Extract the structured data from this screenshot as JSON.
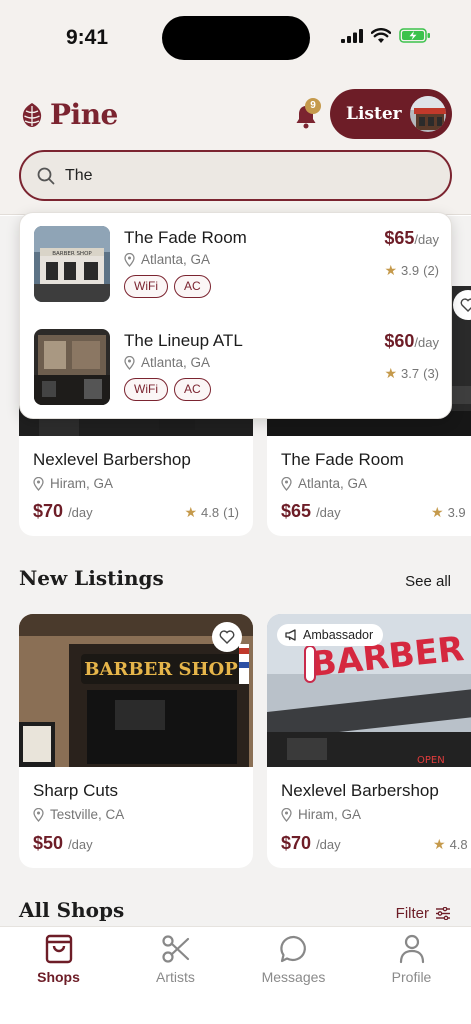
{
  "status": {
    "time": "9:41"
  },
  "header": {
    "logo_text": "Pine",
    "notification_count": "9",
    "lister_label": "Lister",
    "search_value": "The"
  },
  "search_results": [
    {
      "name": "The Fade Room",
      "location": "Atlanta, GA",
      "tags": [
        "WiFi",
        "AC"
      ],
      "price": "$65",
      "per": "/day",
      "rating": "3.9",
      "reviews": "(2)"
    },
    {
      "name": "The Lineup ATL",
      "location": "Atlanta, GA",
      "tags": [
        "WiFi",
        "AC"
      ],
      "price": "$60",
      "per": "/day",
      "rating": "3.7",
      "reviews": "(3)"
    }
  ],
  "featured": [
    {
      "name": "Nexlevel Barbershop",
      "location": "Hiram, GA",
      "price": "$70",
      "per": "/day",
      "rating": "4.8",
      "reviews": "(1)"
    },
    {
      "name": "The Fade Room",
      "location": "Atlanta, GA",
      "price": "$65",
      "per": "/day",
      "rating": "3.9",
      "reviews": ""
    }
  ],
  "new_listings": {
    "title": "New Listings",
    "see_all": "See all",
    "items": [
      {
        "name": "Sharp Cuts",
        "location": "Testville, CA",
        "price": "$50",
        "per": "/day"
      },
      {
        "name": "Nexlevel Barbershop",
        "location": "Hiram, GA",
        "price": "$70",
        "per": "/day",
        "rating": "4.8",
        "badge": "Ambassador"
      }
    ]
  },
  "all_shops": {
    "title": "All Shops",
    "filter": "Filter"
  },
  "tabs": [
    {
      "label": "Shops",
      "icon": "shopping-bag-icon",
      "active": true
    },
    {
      "label": "Artists",
      "icon": "scissors-icon",
      "active": false
    },
    {
      "label": "Messages",
      "icon": "chat-bubble-icon",
      "active": false
    },
    {
      "label": "Profile",
      "icon": "person-icon",
      "active": false
    }
  ],
  "colors": {
    "brand": "#6d1d27",
    "accent": "#c59a4c",
    "background": "#f4f1ee"
  },
  "signage": {
    "sharp_cuts_sign": "BARBER SHOP",
    "nexlevel_sign": "BARBER",
    "fade_room_sign": "BARBER SHOP",
    "open_sign": "OPEN"
  }
}
